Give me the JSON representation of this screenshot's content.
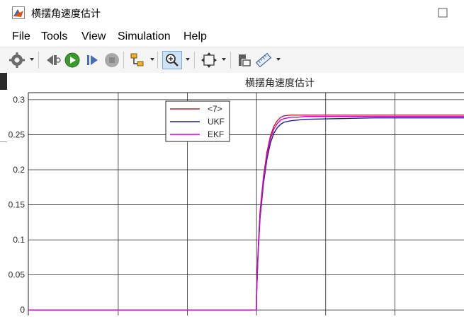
{
  "window": {
    "title": "横摆角速度估计"
  },
  "menu": [
    {
      "label": "File"
    },
    {
      "label": "Tools"
    },
    {
      "label": "View"
    },
    {
      "label": "Simulation"
    },
    {
      "label": "Help"
    }
  ],
  "toolbar": {
    "icons": [
      "gear-icon",
      "step-back-icon",
      "run-icon",
      "step-forward-icon",
      "stop-icon",
      "signal-select-icon",
      "zoom-in-icon",
      "fit-to-view-icon",
      "highlight-block-icon",
      "measure-icon"
    ]
  },
  "colors": {
    "series_1": "#b5232b",
    "series_ukf": "#1f1f8a",
    "series_ekf": "#d000d0",
    "grid": "#262626",
    "background": "#ffffff"
  },
  "chart_data": {
    "type": "line",
    "title": "横摆角速度估计",
    "xlabel": "",
    "ylabel": "",
    "xlim": [
      0,
      6.3
    ],
    "ylim": [
      -0.02,
      0.31
    ],
    "yticks": [
      "0",
      "0.05",
      "0.1",
      "0.15",
      "0.2",
      "0.25",
      "0.3"
    ],
    "ytick_values": [
      0,
      0.05,
      0.1,
      0.15,
      0.2,
      0.25,
      0.3
    ],
    "xgrid": [
      1.3,
      2.3,
      3.3,
      4.3,
      5.3
    ],
    "grid": true,
    "legend_position": "top-center",
    "series": [
      {
        "name": "<7>",
        "color": "#b5232b",
        "x": [
          0,
          3.3,
          3.3,
          3.32,
          3.35,
          3.4,
          3.45,
          3.5,
          3.55,
          3.6,
          3.65,
          3.7,
          3.8,
          3.9,
          4.0,
          4.5,
          5.0,
          6.3
        ],
        "y": [
          0,
          0,
          0.02,
          0.08,
          0.14,
          0.19,
          0.225,
          0.248,
          0.262,
          0.27,
          0.275,
          0.277,
          0.278,
          0.278,
          0.278,
          0.278,
          0.278,
          0.278
        ]
      },
      {
        "name": "UKF",
        "color": "#1f1f8a",
        "x": [
          0,
          3.3,
          3.3,
          3.32,
          3.35,
          3.4,
          3.45,
          3.5,
          3.55,
          3.6,
          3.65,
          3.7,
          3.8,
          3.9,
          4.0,
          4.5,
          5.0,
          6.3
        ],
        "y": [
          0,
          0,
          0.02,
          0.075,
          0.13,
          0.18,
          0.215,
          0.238,
          0.252,
          0.26,
          0.265,
          0.268,
          0.27,
          0.271,
          0.272,
          0.273,
          0.274,
          0.274
        ]
      },
      {
        "name": "EKF",
        "color": "#d000d0",
        "x": [
          0,
          3.3,
          3.3,
          3.32,
          3.35,
          3.4,
          3.45,
          3.5,
          3.55,
          3.6,
          3.65,
          3.7,
          3.8,
          3.9,
          4.0,
          4.5,
          5.0,
          6.3
        ],
        "y": [
          0,
          0,
          0.02,
          0.077,
          0.135,
          0.185,
          0.22,
          0.244,
          0.258,
          0.266,
          0.271,
          0.273,
          0.275,
          0.275,
          0.276,
          0.276,
          0.276,
          0.276
        ]
      }
    ]
  }
}
